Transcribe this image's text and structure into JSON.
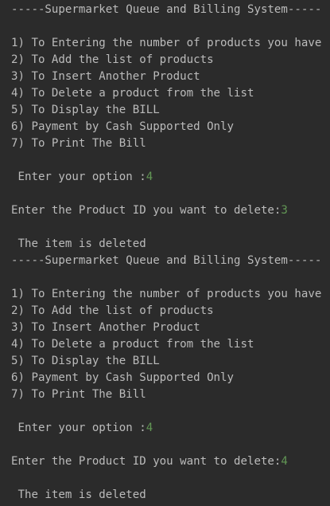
{
  "colors": {
    "background": "#2b2b2b",
    "output_text": "#bbbbbb",
    "user_input": "#629755"
  },
  "console": [
    {
      "text": "-----Supermarket Queue and Billing System-----"
    },
    {
      "text": ""
    },
    {
      "text": "1) To Entering the number of products you have"
    },
    {
      "text": "2) To Add the list of products"
    },
    {
      "text": "3) To Insert Another Product"
    },
    {
      "text": "4) To Delete a product from the list"
    },
    {
      "text": "5) To Display the BILL"
    },
    {
      "text": "6) Payment by Cash Supported Only"
    },
    {
      "text": "7) To Print The Bill"
    },
    {
      "text": ""
    },
    {
      "text": " Enter your option :",
      "input": "4"
    },
    {
      "text": ""
    },
    {
      "text": "Enter the Product ID you want to delete:",
      "input": "3"
    },
    {
      "text": ""
    },
    {
      "text": " The item is deleted"
    },
    {
      "text": "-----Supermarket Queue and Billing System-----"
    },
    {
      "text": ""
    },
    {
      "text": "1) To Entering the number of products you have"
    },
    {
      "text": "2) To Add the list of products"
    },
    {
      "text": "3) To Insert Another Product"
    },
    {
      "text": "4) To Delete a product from the list"
    },
    {
      "text": "5) To Display the BILL"
    },
    {
      "text": "6) Payment by Cash Supported Only"
    },
    {
      "text": "7) To Print The Bill"
    },
    {
      "text": ""
    },
    {
      "text": " Enter your option :",
      "input": "4"
    },
    {
      "text": ""
    },
    {
      "text": "Enter the Product ID you want to delete:",
      "input": "4"
    },
    {
      "text": ""
    },
    {
      "text": " The item is deleted"
    }
  ]
}
